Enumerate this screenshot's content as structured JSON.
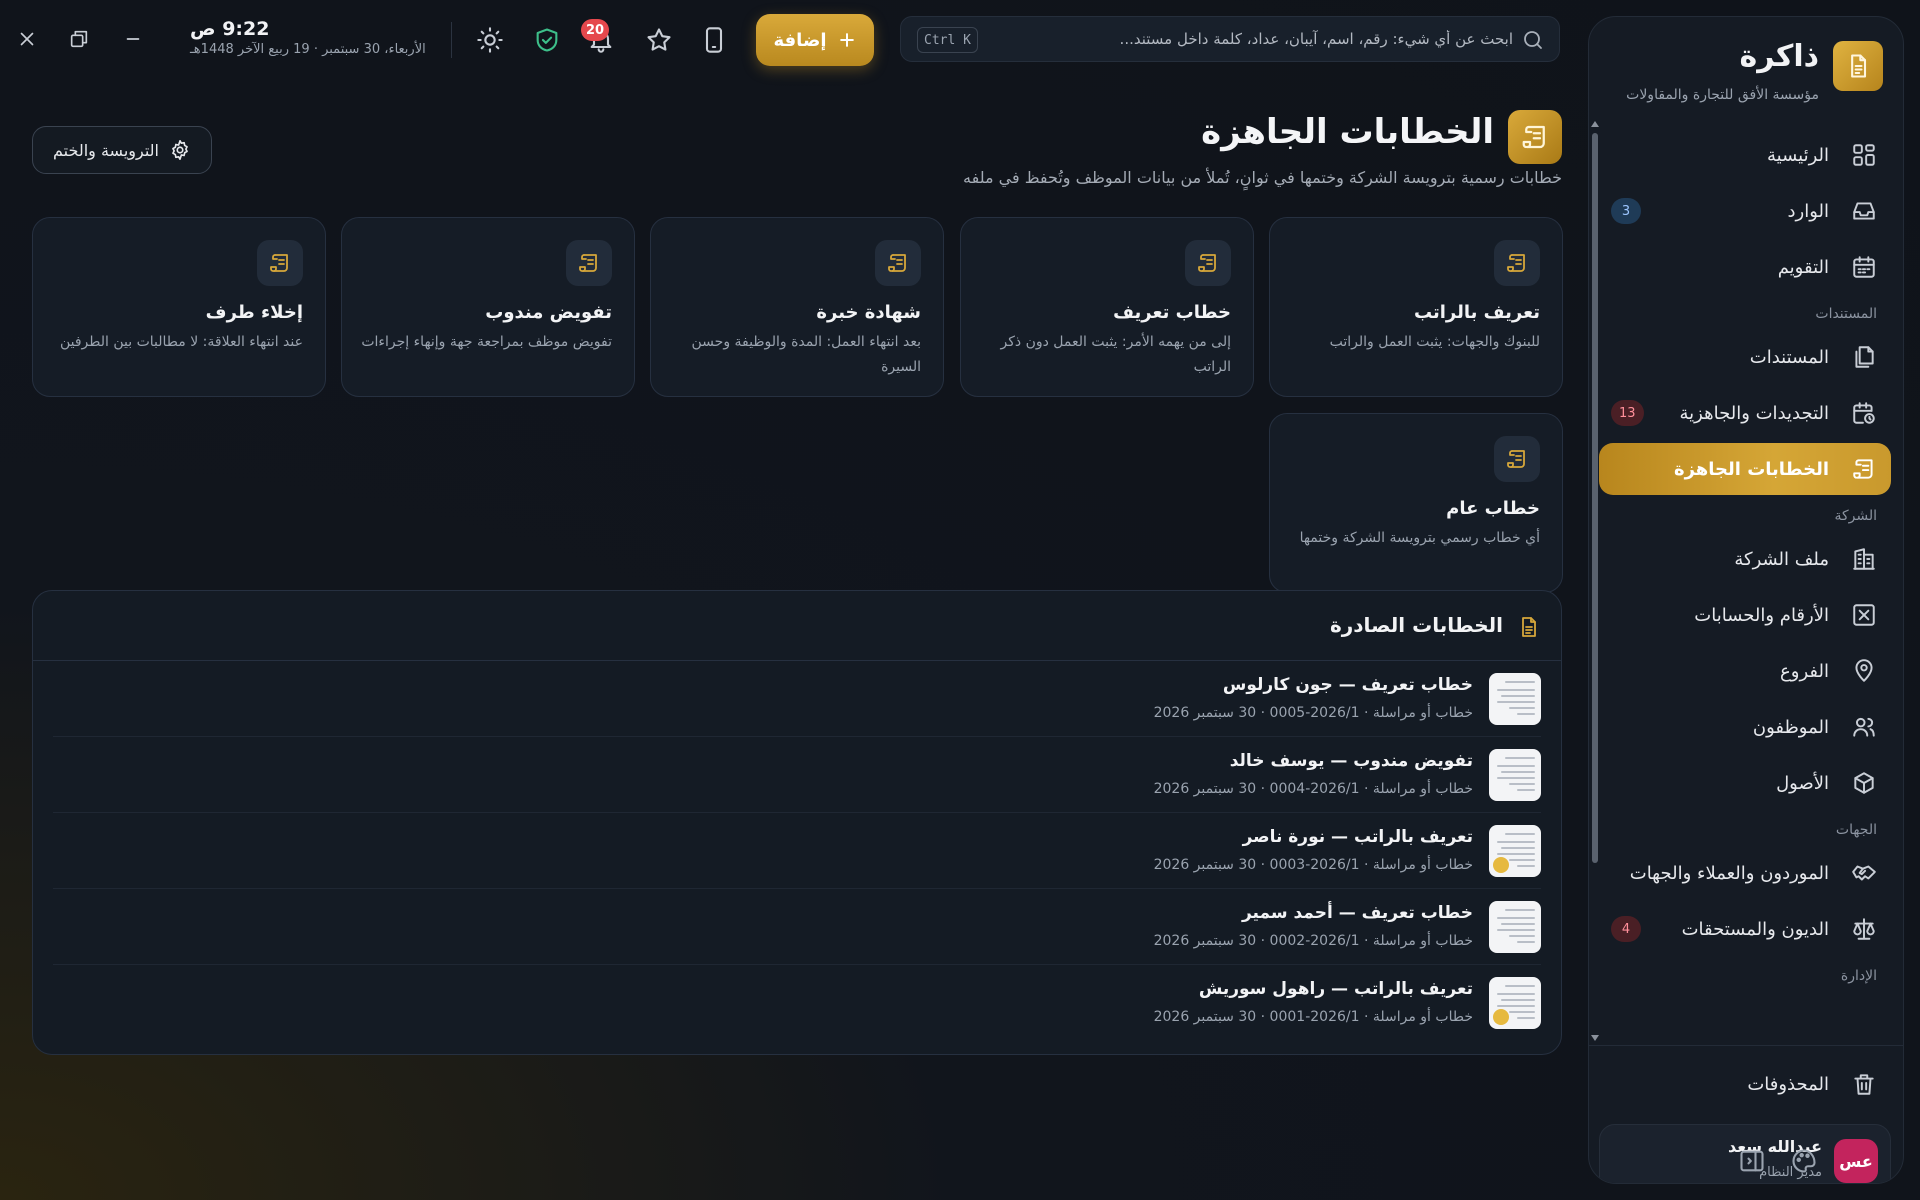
{
  "brand": {
    "name": "ذاكرة",
    "subtitle": "مؤسسة الأفق للتجارة والمقاولات"
  },
  "nav": {
    "home": "الرئيسية",
    "inbox": "الوارد",
    "inbox_count": "3",
    "calendar": "التقويم",
    "section_documents": "المستندات",
    "documents": "المستندات",
    "renewals": "التجديدات والجاهزية",
    "renewals_count": "13",
    "letters": "الخطابات الجاهزة",
    "section_company": "الشركة",
    "company_profile": "ملف الشركة",
    "numbers_accounts": "الأرقام والحسابات",
    "branches": "الفروع",
    "employees": "الموظفون",
    "assets": "الأصول",
    "section_parties": "الجهات",
    "suppliers": "الموردون والعملاء والجهات",
    "debts": "الديون والمستحقات",
    "debts_count": "4",
    "section_admin": "الإدارة",
    "trash": "المحذوفات"
  },
  "user": {
    "initials": "عس",
    "name": "عبدالله سعد",
    "role": "مدير النظام"
  },
  "topbar": {
    "search_placeholder": "ابحث عن أي شيء: رقم، اسم، آيبان، عداد، كلمة داخل مستند...",
    "search_shortcut": "Ctrl K",
    "add_label": "إضافة",
    "notifications_count": "20",
    "time": "9:22 ص",
    "date": "الأربعاء، 30 سبتمبر · 19 ربيع الآخر 1448هـ"
  },
  "page": {
    "title": "الخطابات الجاهزة",
    "subtitle": "خطابات رسمية بترويسة الشركة وختمها في ثوانٍ، تُملأ من بيانات الموظف وتُحفظ في ملفه",
    "letterhead_button": "الترويسة والختم"
  },
  "templates": [
    {
      "title": "تعريف بالراتب",
      "desc": "للبنوك والجهات: يثبت العمل والراتب"
    },
    {
      "title": "خطاب تعريف",
      "desc": "إلى من يهمه الأمر: يثبت العمل دون ذكر الراتب"
    },
    {
      "title": "شهادة خبرة",
      "desc": "بعد انتهاء العمل: المدة والوظيفة وحسن السيرة"
    },
    {
      "title": "تفويض مندوب",
      "desc": "تفويض موظف بمراجعة جهة وإنهاء إجراءات"
    },
    {
      "title": "إخلاء طرف",
      "desc": "عند انتهاء العلاقة: لا مطالبات بين الطرفين"
    },
    {
      "title": "خطاب عام",
      "desc": "أي خطاب رسمي بترويسة الشركة وختمها"
    }
  ],
  "issued": {
    "title": "الخطابات الصادرة",
    "rows": [
      {
        "title": "خطاب تعريف — جون كارلوس",
        "meta": "خطاب أو مراسلة · 2026/1-0005 · 30 سبتمبر 2026",
        "stamp": false
      },
      {
        "title": "تفويض مندوب — يوسف خالد",
        "meta": "خطاب أو مراسلة · 2026/1-0004 · 30 سبتمبر 2026",
        "stamp": false
      },
      {
        "title": "تعريف بالراتب — نورة ناصر",
        "meta": "خطاب أو مراسلة · 2026/1-0003 · 30 سبتمبر 2026",
        "stamp": true
      },
      {
        "title": "خطاب تعريف — أحمد سمير",
        "meta": "خطاب أو مراسلة · 2026/1-0002 · 30 سبتمبر 2026",
        "stamp": false
      },
      {
        "title": "تعريف بالراتب — راهول سوريش",
        "meta": "خطاب أو مراسلة · 2026/1-0001 · 30 سبتمبر 2026",
        "stamp": true
      }
    ]
  },
  "colors": {
    "accent": "#d5a636",
    "background": "#0f131a",
    "danger": "#e5484d"
  }
}
